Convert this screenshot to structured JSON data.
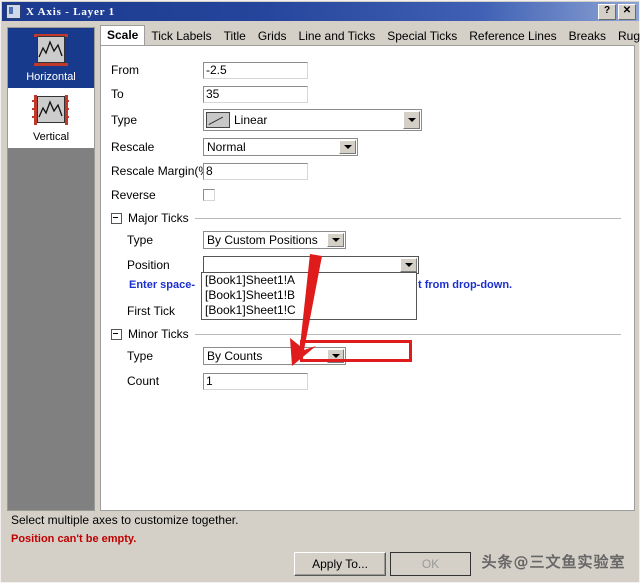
{
  "window": {
    "title": "X Axis - Layer 1",
    "help_button": "?",
    "close_button": "✕",
    "icon": "axis-dialog-icon"
  },
  "sidebar": {
    "items": [
      {
        "label": "Horizontal",
        "icon": "horizontal-axis-icon",
        "selected": true
      },
      {
        "label": "Vertical",
        "icon": "vertical-axis-icon",
        "selected": false
      }
    ]
  },
  "tabs": [
    {
      "label": "Scale",
      "active": true
    },
    {
      "label": "Tick Labels",
      "active": false
    },
    {
      "label": "Title",
      "active": false
    },
    {
      "label": "Grids",
      "active": false
    },
    {
      "label": "Line and Ticks",
      "active": false
    },
    {
      "label": "Special Ticks",
      "active": false
    },
    {
      "label": "Reference Lines",
      "active": false
    },
    {
      "label": "Breaks",
      "active": false
    },
    {
      "label": "Rug",
      "active": false
    }
  ],
  "scale": {
    "from_label": "From",
    "from_value": "-2.5",
    "to_label": "To",
    "to_value": "35",
    "type_label": "Type",
    "type_value": "Linear",
    "type_icon": "linear-scale-icon",
    "rescale_label": "Rescale",
    "rescale_value": "Normal",
    "rescale_margin_label": "Rescale Margin(%)",
    "rescale_margin_value": "8",
    "reverse_label": "Reverse",
    "reverse_checked": false
  },
  "major_ticks": {
    "group_label": "Major Ticks",
    "type_label": "Type",
    "type_value": "By Custom Positions",
    "position_label": "Position",
    "position_value": "",
    "hint_left": "Enter space-",
    "hint_right": "t from drop-down.",
    "first_tick_label": "First Tick",
    "first_tick_value": ""
  },
  "dropdown": {
    "options": [
      "[Book1]Sheet1!A",
      "[Book1]Sheet1!B",
      "[Book1]Sheet1!C"
    ]
  },
  "minor_ticks": {
    "group_label": "Minor Ticks",
    "type_label": "Type",
    "type_value": "By Counts",
    "count_label": "Count",
    "count_value": "1"
  },
  "footer": {
    "status_text": "Select multiple axes to customize together.",
    "error_text": "Position can't be empty.",
    "apply_to_label": "Apply To...",
    "ok_label": "OK",
    "ok_disabled": true
  },
  "watermark": {
    "text": "头条@三文鱼实验室"
  },
  "colors": {
    "title_bar": "#1b3a8f",
    "selection": "#183a8c",
    "hint": "#1a2fd0",
    "error": "#c00000",
    "annotation": "#e01b1b",
    "panel_bg": "#d4d0c8"
  }
}
